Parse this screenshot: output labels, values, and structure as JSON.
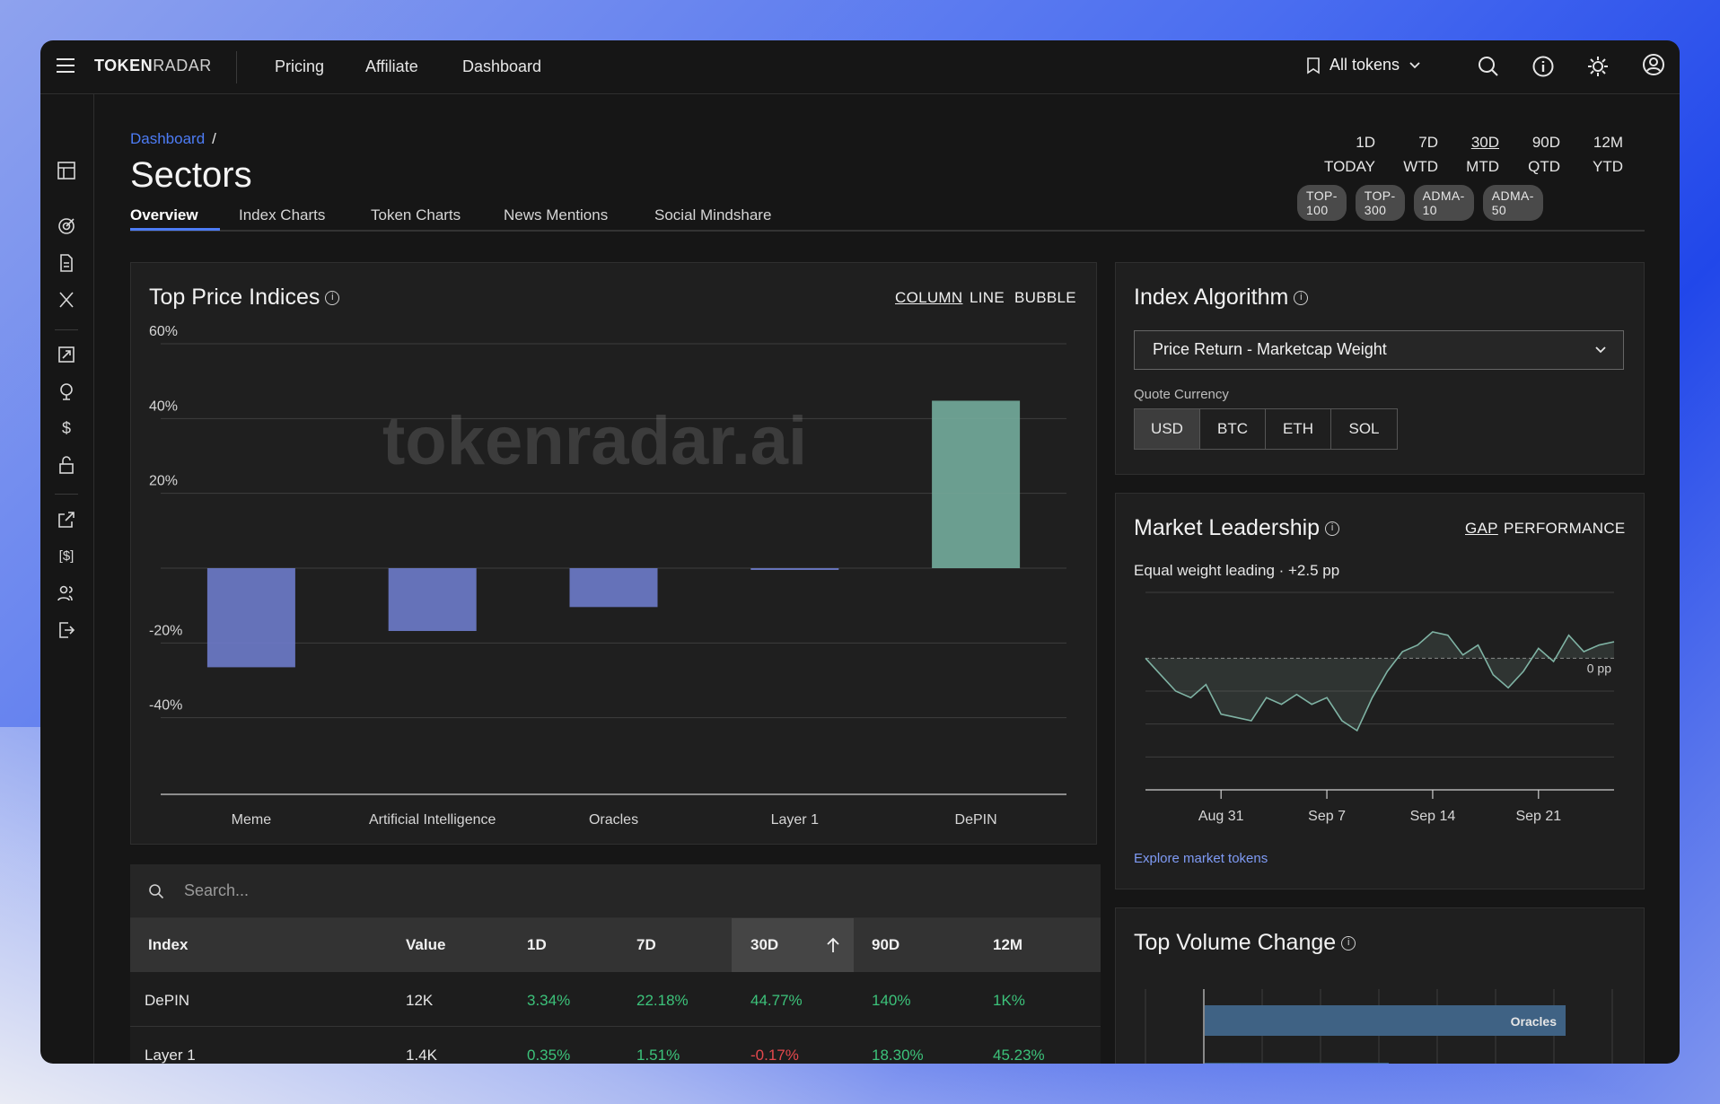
{
  "app": {
    "logo_bold": "TOKEN",
    "logo_light": "RADAR"
  },
  "nav": {
    "links": [
      "Pricing",
      "Affiliate",
      "Dashboard"
    ]
  },
  "topbar": {
    "token_filter": "All tokens"
  },
  "breadcrumb": {
    "parent": "Dashboard",
    "separator": "/"
  },
  "page": {
    "title": "Sectors"
  },
  "periods": [
    {
      "top": "1D",
      "bottom": "TODAY",
      "selected": false
    },
    {
      "top": "7D",
      "bottom": "WTD",
      "selected": false
    },
    {
      "top": "30D",
      "bottom": "MTD",
      "selected": true
    },
    {
      "top": "90D",
      "bottom": "QTD",
      "selected": false
    },
    {
      "top": "12M",
      "bottom": "YTD",
      "selected": false
    }
  ],
  "chips": [
    "TOP-100",
    "TOP-300",
    "ADMA-10",
    "ADMA-50"
  ],
  "tabs": [
    "Overview",
    "Index Charts",
    "Token Charts",
    "News Mentions",
    "Social Mindshare"
  ],
  "top_price": {
    "title": "Top Price Indices",
    "chart_types": [
      "COLUMN",
      "LINE",
      "BUBBLE"
    ],
    "selected_type": "COLUMN",
    "watermark": "tokenradar.ai"
  },
  "chart_data": [
    {
      "type": "bar",
      "title": "Top Price Indices",
      "categories": [
        "Meme",
        "Artificial Intelligence",
        "Oracles",
        "Layer 1",
        "DePIN"
      ],
      "values": [
        -26.5,
        -16.8,
        -10.4,
        -0.17,
        44.77
      ],
      "bar_colors": [
        "#6b79c7",
        "#6b79c7",
        "#6b79c7",
        "#6b79c7",
        "#72a99a"
      ],
      "ytick_labels": [
        "60%",
        "40%",
        "20%",
        "",
        "-20%",
        "-40%"
      ],
      "yticks": [
        60,
        40,
        20,
        0,
        -20,
        -40
      ],
      "ylim": [
        -60,
        60
      ],
      "grid": true
    },
    {
      "type": "line",
      "title": "Market Leadership",
      "subtitle": "Equal weight leading · +2.5 pp",
      "x": [
        "Aug 26",
        "Aug 27",
        "Aug 28",
        "Aug 29",
        "Aug 30",
        "Aug 31",
        "Sep 1",
        "Sep 2",
        "Sep 3",
        "Sep 4",
        "Sep 5",
        "Sep 6",
        "Sep 7",
        "Sep 8",
        "Sep 9",
        "Sep 10",
        "Sep 11",
        "Sep 12",
        "Sep 13",
        "Sep 14",
        "Sep 15",
        "Sep 16",
        "Sep 17",
        "Sep 18",
        "Sep 19",
        "Sep 20",
        "Sep 21",
        "Sep 22",
        "Sep 23",
        "Sep 24",
        "Sep 25",
        "Sep 26"
      ],
      "values": [
        0,
        -2.5,
        -5,
        -6,
        -4,
        -8.5,
        -9,
        -9.5,
        -6,
        -7,
        -5.5,
        -7,
        -6,
        -9.5,
        -11,
        -6,
        -2,
        1,
        2,
        4,
        3.5,
        0.5,
        2,
        -2.5,
        -4.5,
        -2,
        1.5,
        -0.5,
        3.5,
        1,
        2,
        2.5
      ],
      "x_tick_labels": [
        "Aug 31",
        "Sep 7",
        "Sep 14",
        "Sep 21"
      ],
      "reference_label": "0 pp",
      "reference_value": 0,
      "ylim": [
        -20,
        10
      ]
    },
    {
      "type": "bar",
      "title": "Top Volume Change",
      "orientation": "horizontal",
      "categories": [
        "Oracles"
      ],
      "values": [
        100
      ]
    }
  ],
  "algorithm": {
    "title": "Index Algorithm",
    "selected": "Price Return - Marketcap Weight",
    "quote_label": "Quote Currency",
    "currencies": [
      "USD",
      "BTC",
      "ETH",
      "SOL"
    ],
    "selected_currency": "USD"
  },
  "leadership": {
    "title": "Market Leadership",
    "modes": [
      "GAP",
      "PERFORMANCE"
    ],
    "selected_mode": "GAP",
    "summary": "Equal weight leading · +2.5 pp",
    "zero_label": "0 pp",
    "link": "Explore market tokens"
  },
  "volume": {
    "title": "Top Volume Change",
    "bar_label": "Oracles"
  },
  "table": {
    "search_placeholder": "Search...",
    "columns": [
      "Index",
      "Value",
      "1D",
      "7D",
      "30D",
      "90D",
      "12M"
    ],
    "sorted_column": "30D",
    "rows": [
      {
        "index": "DePIN",
        "value": "12K",
        "d1": "3.34%",
        "d7": "22.18%",
        "d30": "44.77%",
        "d90": "140%",
        "m12": "1K%"
      },
      {
        "index": "Layer 1",
        "value": "1.4K",
        "d1": "0.35%",
        "d7": "1.51%",
        "d30": "-0.17%",
        "d90": "18.30%",
        "m12": "45.23%"
      }
    ]
  },
  "colors": {
    "accent": "#4d7cf5",
    "positive": "#3cc27a",
    "negative": "#e5484d",
    "bar_negative": "#6b79c7",
    "bar_positive": "#72a99a"
  }
}
